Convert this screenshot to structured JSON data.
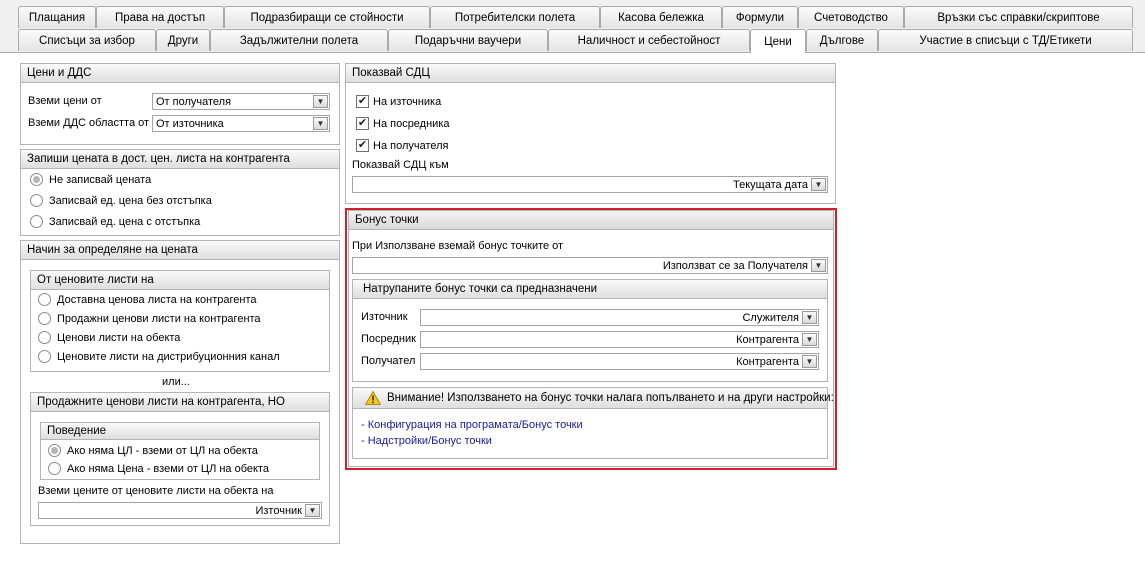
{
  "tabs_row1": [
    {
      "label": "Плащания"
    },
    {
      "label": "Права на достъп"
    },
    {
      "label": "Подразбиращи се стойности"
    },
    {
      "label": "Потребителски полета"
    },
    {
      "label": "Касова бележка"
    },
    {
      "label": "Формули"
    },
    {
      "label": "Счетоводство"
    },
    {
      "label": "Връзки със справки/скриптове"
    }
  ],
  "tabs_row2": [
    {
      "label": "Списъци за избор"
    },
    {
      "label": "Други"
    },
    {
      "label": "Задължителни полета"
    },
    {
      "label": "Подаръчни ваучери"
    },
    {
      "label": "Наличност и себестойност"
    },
    {
      "label": "Цени"
    },
    {
      "label": "Дългове"
    },
    {
      "label": "Участие в списъци с ТД/Етикети"
    }
  ],
  "prices_vat": {
    "title": "Цени и ДДС",
    "take_prices_label": "Вземи цени от",
    "take_prices_value": "От получателя",
    "take_vat_label": "Вземи ДДС областта от",
    "take_vat_value": "От източника"
  },
  "record_price": {
    "title": "Запиши цената в дост. цен. листа на контрагента",
    "options": [
      "Не записвай цената",
      "Записвай ед. цена без отстъпка",
      "Записвай ед. цена с отстъпка"
    ],
    "selected": 0
  },
  "price_method": {
    "title": "Начин за определяне на цената",
    "from_lists_title": "От ценовите листи на",
    "options": [
      "Доставна ценова листа на контрагента",
      "Продажни ценови листи на контрагента",
      "Ценови листи на обекта",
      "Ценовите листи на дистрибуционния канал"
    ],
    "or_text": "или...",
    "sales_lists_title": "Продажните ценови листи на контрагента, НО",
    "behavior_title": "Поведение",
    "behavior_options": [
      "Ако няма ЦЛ - вземи от ЦЛ на обекта",
      "Ако няма Цена - вземи от ЦЛ на обекта"
    ],
    "behavior_selected": 0,
    "object_lists_label": "Вземи цените от ценовите листи на обекта на",
    "object_lists_value": "Източник"
  },
  "show_sdc": {
    "title": "Показвай СДЦ",
    "checks": [
      {
        "label": "На източника",
        "checked": true
      },
      {
        "label": "На посредника",
        "checked": true
      },
      {
        "label": "На получателя",
        "checked": true
      }
    ],
    "to_label": "Показвай СДЦ към",
    "to_value": "Текущата дата"
  },
  "bonus": {
    "title": "Бонус точки",
    "use_label": "При Използване вземай бонус точките от",
    "use_value": "Използват се за Получателя",
    "accum_title": "Натрупаните бонус точки са предназначени",
    "source_label": "Източник",
    "source_value": "Служителя",
    "middle_label": "Посредник",
    "middle_value": "Контрагента",
    "receiver_label": "Получател",
    "receiver_value": "Контрагента",
    "warning": "Внимание! Използването на бонус точки налага попълването и на други настройки:",
    "links": [
      "- Конфигурация на програмата/Бонус точки",
      "- Надстройки/Бонус точки"
    ]
  },
  "colors": {
    "highlight_border": "#d0202a",
    "link": "#1a1a9a"
  }
}
